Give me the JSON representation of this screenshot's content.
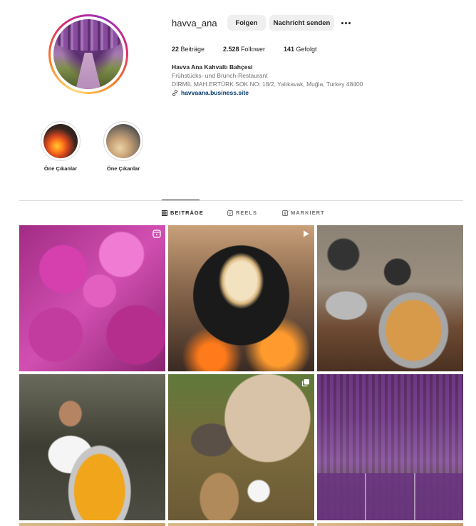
{
  "profile": {
    "username": "havva_ana",
    "follow_label": "Folgen",
    "message_label": "Nachricht senden",
    "stats": {
      "posts_count": "22",
      "posts_label": " Beiträge",
      "followers_count": "2.528",
      "followers_label": " Follower",
      "following_count": "141",
      "following_label": " Gefolgt"
    },
    "bio": {
      "name": "Havva Ana Kahvaltı Bahçesi",
      "category": "Frühstücks- und Brunch-Restaurant",
      "address": "DİRMİL MAH.ERTÜRK SOK.NO: 18/2, Yalıkavak, Muğla, Turkey 48400",
      "link": "havvaana.business.site"
    }
  },
  "highlights": [
    {
      "label": "Öne Çıkanlar"
    },
    {
      "label": "Öne Çıkanlar"
    }
  ],
  "tabs": [
    {
      "label": "BEITRÄGE",
      "active": true,
      "icon": "grid-icon"
    },
    {
      "label": "REELS",
      "active": false,
      "icon": "reels-icon"
    },
    {
      "label": "MARKIERT",
      "active": false,
      "icon": "tagged-icon"
    }
  ],
  "posts": [
    {
      "subject": "pink hydrangea flowers",
      "badge": "reel-icon"
    },
    {
      "subject": "flatbread cooking on iron griddle over fire",
      "badge": "play-icon"
    },
    {
      "subject": "woman at stone oven with baked pastry tray",
      "badge": ""
    },
    {
      "subject": "woman holding plate of stuffed zucchini flowers",
      "badge": ""
    },
    {
      "subject": "woman milking a cow",
      "badge": "carousel-icon"
    },
    {
      "subject": "wisteria-covered garden path",
      "badge": ""
    }
  ],
  "colors": {
    "link": "#00376b",
    "secondary_text": "#737373",
    "button_bg": "#efefef",
    "divider": "#dbdbdb"
  }
}
